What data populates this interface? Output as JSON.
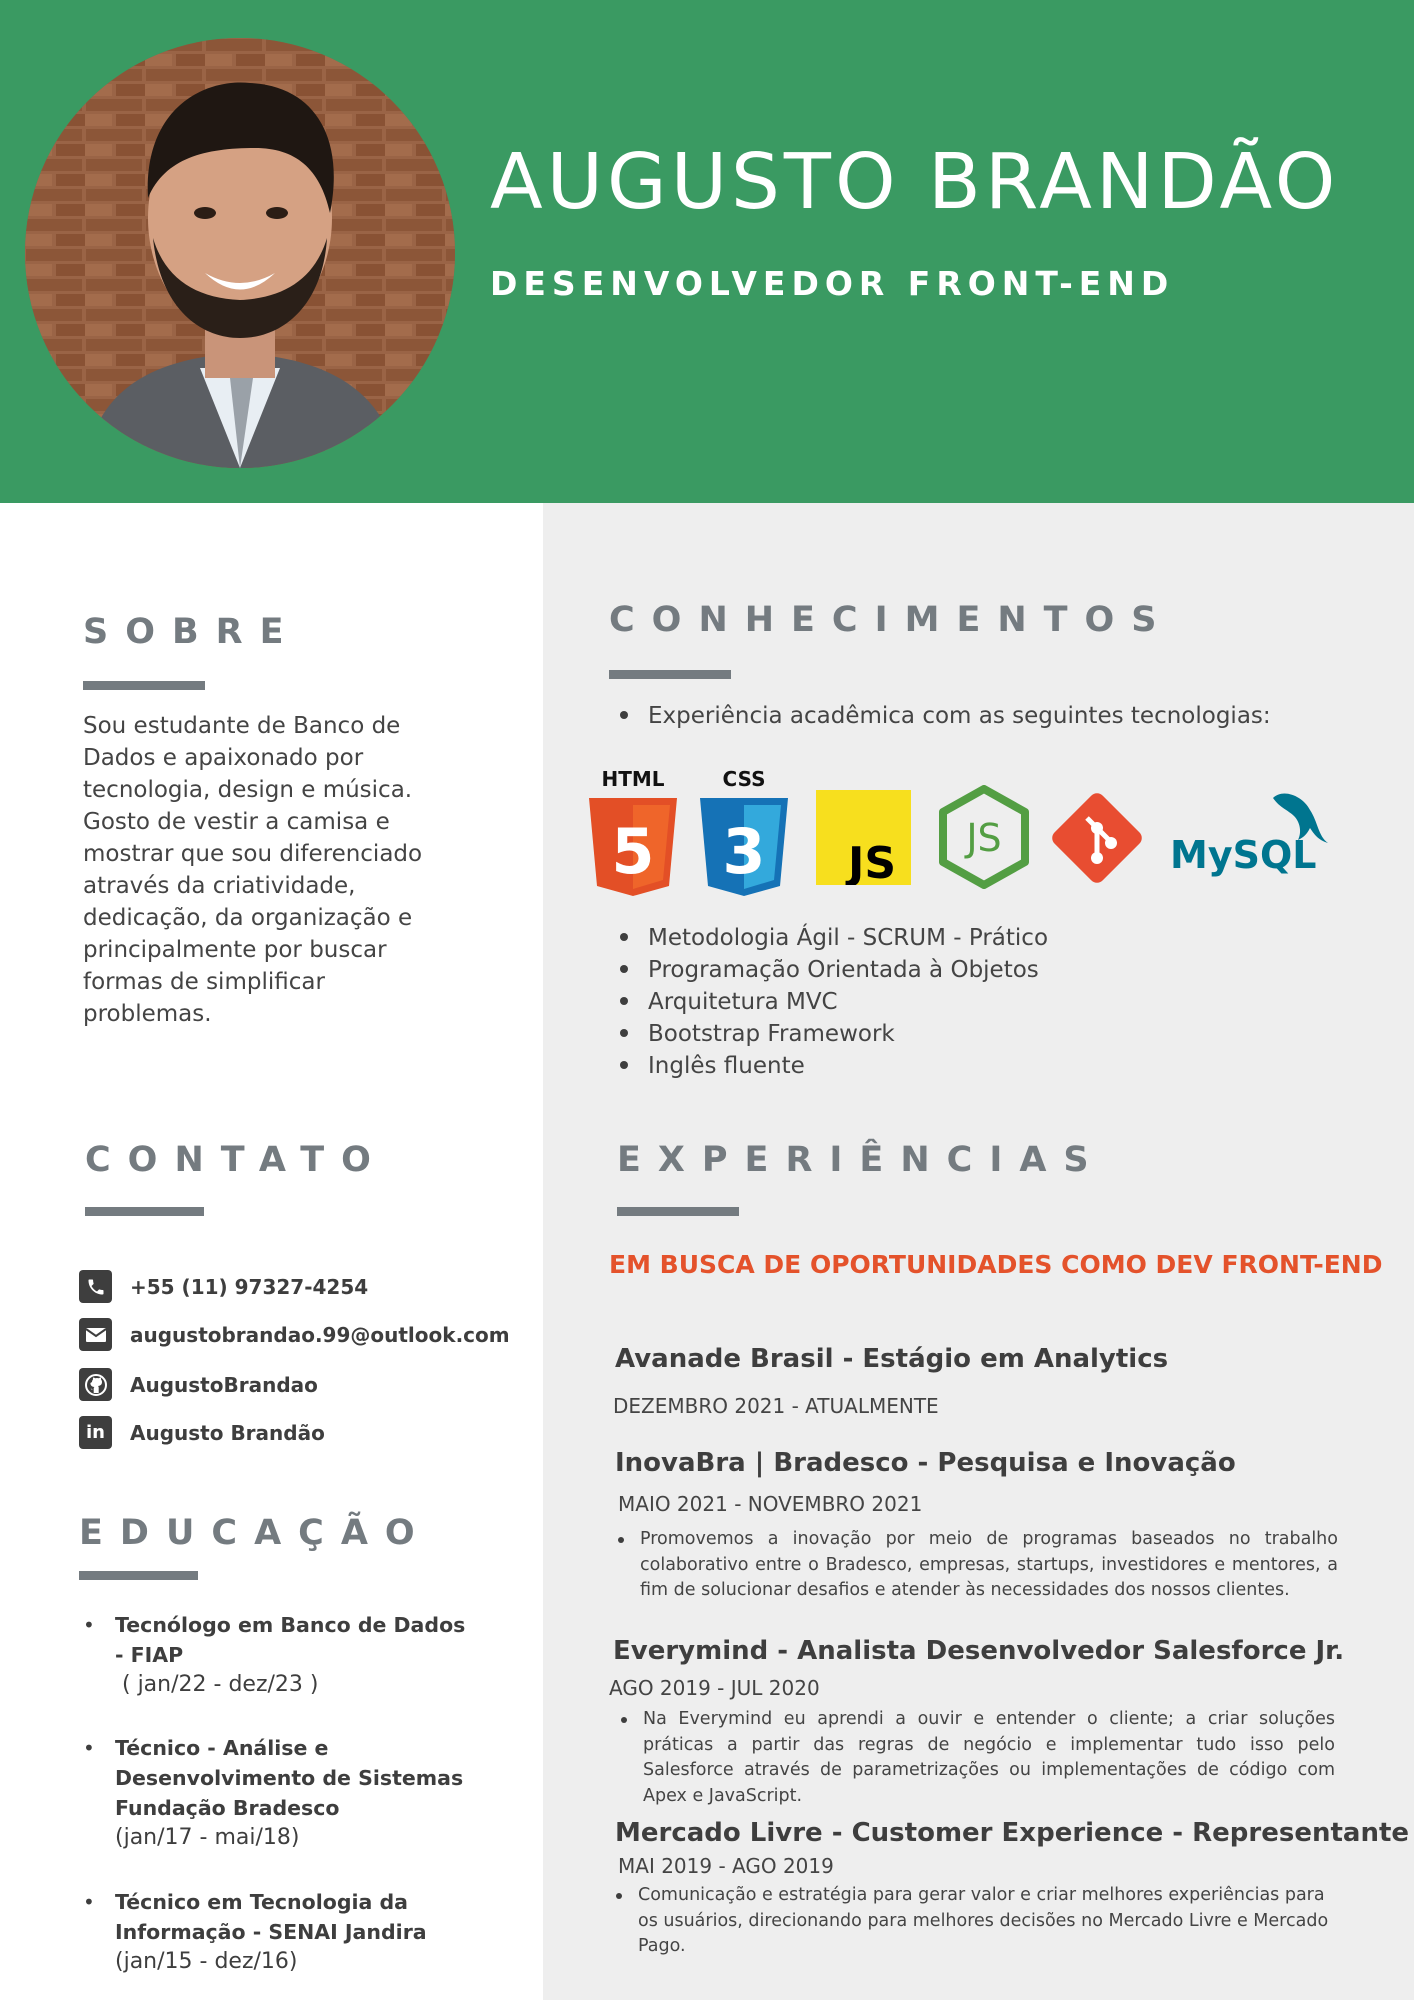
{
  "header": {
    "name": "AUGUSTO BRANDÃO",
    "role": "DESENVOLVEDOR FRONT-END",
    "bg_color": "#3a9a62"
  },
  "about": {
    "title": "SOBRE",
    "text": "Sou estudante de Banco de Dados e apaixonado por tecnologia, design e música. Gosto de vestir a camisa e mostrar que sou diferenciado através da criatividade, dedicação, da organização e principalmente por buscar formas de simplificar problemas."
  },
  "contact": {
    "title": "CONTATO",
    "items": [
      {
        "icon": "phone-icon",
        "text": "+55 (11) 97327-4254"
      },
      {
        "icon": "email-icon",
        "text": "augustobrandao.99@outlook.com"
      },
      {
        "icon": "github-icon",
        "text": "AugustoBrandao"
      },
      {
        "icon": "linkedin-icon",
        "text": "Augusto Brandão"
      }
    ]
  },
  "education": {
    "title": "EDUCAÇÃO",
    "items": [
      {
        "title": "Tecnólogo em Banco de Dados - FIAP",
        "dates": " ( jan/22 - dez/23 )"
      },
      {
        "title": "Técnico - Análise e Desenvolvimento de Sistemas Fundação Bradesco",
        "dates": "(jan/17 - mai/18)"
      },
      {
        "title": "Técnico em Tecnologia da Informação - SENAI Jandira",
        "dates": "(jan/15 - dez/16)"
      }
    ]
  },
  "skills": {
    "title": "CONHECIMENTOS",
    "intro": "Experiência acadêmica com as seguintes tecnologias:",
    "logos": {
      "html": "HTML",
      "html_num": "5",
      "css": "CSS",
      "css_num": "3",
      "js": "JS",
      "node": "JS",
      "mysql": "MySQL"
    },
    "items": [
      "Metodologia Ágil -  SCRUM - Prático",
      "Programação Orientada à Objetos",
      "Arquitetura MVC",
      "Bootstrap Framework",
      "Inglês fluente"
    ]
  },
  "experience": {
    "title": "EXPERIÊNCIAS",
    "cta": "EM BUSCA DE OPORTUNIDADES COMO DEV FRONT-END",
    "cta_color": "#e4522b",
    "jobs": [
      {
        "title": "Avanade Brasil - Estágio em Analytics",
        "date": "DEZEMBRO 2021 - ATUALMENTE",
        "desc": ""
      },
      {
        "title": "InovaBra | Bradesco - Pesquisa e Inovação",
        "date": "MAIO 2021 - NOVEMBRO 2021",
        "desc": "Promovemos a inovação por meio de programas baseados no trabalho colaborativo entre o Bradesco, empresas, startups, investidores e mentores, a fim de solucionar desafios e atender às necessidades dos nossos clientes."
      },
      {
        "title": "Everymind - Analista Desenvolvedor Salesforce Jr.",
        "date": "AGO 2019 - JUL 2020",
        "desc": "Na Everymind eu aprendi a ouvir e entender o cliente; a criar soluções práticas a partir das regras de negócio e implementar tudo isso pelo Salesforce através de parametrizações ou implementações de código com Apex e JavaScript."
      },
      {
        "title": "Mercado Livre - Customer Experience - Representante Jr.",
        "date": "MAI 2019 - AGO 2019",
        "desc": "Comunicação e estratégia para gerar valor e criar melhores experiências para os usuários, direcionando para melhores decisões no Mercado Livre e Mercado Pago."
      }
    ]
  }
}
